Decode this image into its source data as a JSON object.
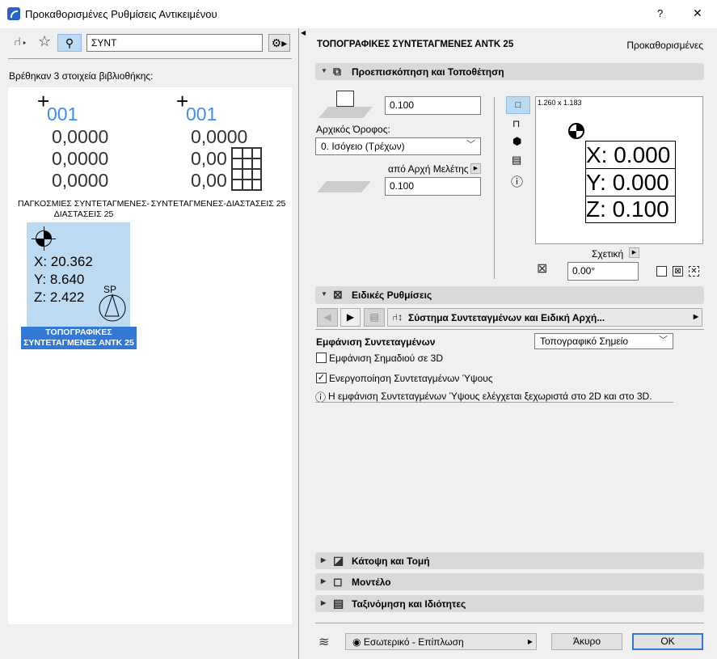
{
  "window": {
    "title": "Προκαθορισμένες Ρυθμίσεις Αντικειμένου",
    "help": "?",
    "close": "✕"
  },
  "left": {
    "search_value": "ΣΥΝΤ",
    "found_text": "Βρέθηκαν 3 στοιχεία βιβλιοθήκης:",
    "items": [
      {
        "label": "ΠΑΓΚΟΣΜΙΕΣ ΣΥΝΤΕΤΑΓΜΕΝΕΣ-ΔΙΑΣΤΑΣΕΙΣ 25",
        "id": "001",
        "values": [
          "0,0000",
          "0,0000",
          "0,0000"
        ]
      },
      {
        "label": "ΣΥΝΤΕΤΑΓΜΕΝΕΣ-ΔΙΑΣΤΑΣΕΙΣ 25",
        "id": "001",
        "values": [
          "0,0000",
          "0,00",
          "0,00"
        ]
      },
      {
        "label": "ΤΟΠΟΓΡΑΦΙΚΕΣ ΣΥΝΤΕΤΑΓΜΕΝΕΣ ΑΝΤΚ 25",
        "values": [
          "X: 20.362",
          "Y: 8.640",
          "Z: 2.422"
        ],
        "badge": "SP",
        "selected": true
      }
    ]
  },
  "right": {
    "title": "ΤΟΠΟΓΡΑΦΙΚΕΣ ΣΥΝΤΕΤΑΓΜΕΝΕΣ ΑΝΤΚ 25",
    "default_label": "Προκαθορισμένες",
    "sections": {
      "placement": "Προεπισκόπηση και Τοποθέτηση",
      "special": "Ειδικές Ρυθμίσεις",
      "plan": "Κάτοψη και Τομή",
      "model": "Μοντέλο",
      "classification": "Ταξινόμηση και Ιδιότητες"
    },
    "placement": {
      "height_value": "0.100",
      "home_floor_label": "Αρχικός Όροφος:",
      "home_floor_value": "0. Ισόγειο (Τρέχων)",
      "ref_label": "από Αρχή Μελέτης",
      "elevation_value": "0.100",
      "preview_size": "1.260 x 1.183",
      "preview_lines": [
        "X: 0.000",
        "Y: 0.000",
        "Z: 0.100"
      ],
      "relative_label": "Σχετική",
      "angle_value": "0.00°"
    },
    "special": {
      "page_title": "Σύστημα Συντεταγμένων και Ειδική Αρχή...",
      "display_label": "Εμφάνιση Συντεταγμένων",
      "display_value": "Τοπογραφικό Σημείο",
      "cb1_label": "Εμφάνιση Σημαδιού σε 3D",
      "cb1_checked": false,
      "cb2_label": "Ενεργοποίηση Συντεταγμένων Ύψους",
      "cb2_checked": true,
      "info": "Η εμφάνιση Συντεταγμένων Ύψους ελέγχεται ξεχωριστά στο 2D και στο 3D."
    },
    "footer": {
      "layer": "Εσωτερικό - Επίπλωση",
      "cancel": "Άκυρο",
      "ok": "OK"
    }
  },
  "colors": {
    "accent": "#3478d6",
    "selection": "#bcdaf2",
    "id_blue": "#3b8ef0"
  }
}
